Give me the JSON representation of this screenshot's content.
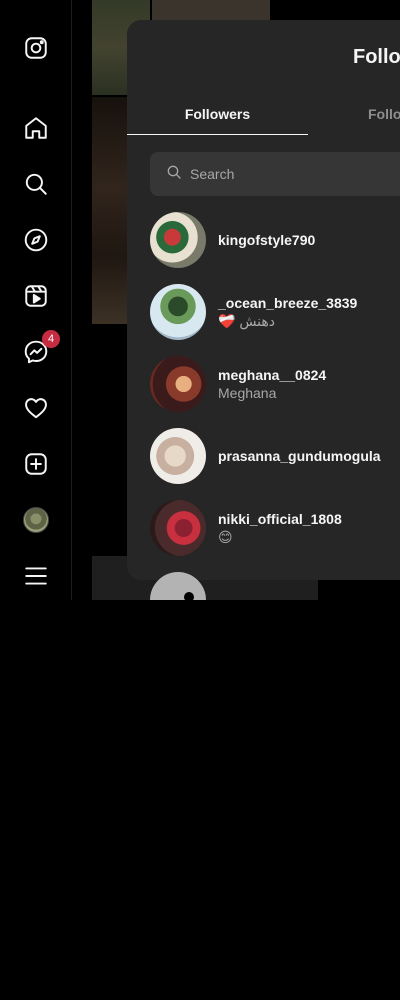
{
  "nav": {
    "items": [
      {
        "icon": "instagram-logo-icon"
      },
      {
        "icon": "home-icon"
      },
      {
        "icon": "search-icon"
      },
      {
        "icon": "explore-compass-icon"
      },
      {
        "icon": "reels-icon"
      },
      {
        "icon": "messenger-icon",
        "badge": "4"
      },
      {
        "icon": "heart-icon"
      },
      {
        "icon": "create-plus-icon"
      },
      {
        "icon": "profile-avatar"
      },
      {
        "icon": "menu-hamburger-icon"
      }
    ],
    "messages_badge": "4"
  },
  "modal": {
    "title": "Follo",
    "tabs": [
      {
        "label": "Followers",
        "active": true
      },
      {
        "label": "Follo",
        "active": false
      }
    ],
    "search": {
      "placeholder": "Search",
      "value": ""
    },
    "users": [
      {
        "username": "kingofstyle790",
        "fullname": ""
      },
      {
        "username": "_ocean_breeze_3839",
        "fullname": "❤️‍🩹 دهنش"
      },
      {
        "username": "meghana__0824",
        "fullname": "Meghana"
      },
      {
        "username": "prasanna_gundumogula",
        "fullname": ""
      },
      {
        "username": "nikki_official_1808",
        "fullname": "😊"
      }
    ]
  },
  "colors": {
    "background": "#000000",
    "modal": "#262626",
    "search_bg": "#363636",
    "badge": "#c72c41",
    "secondary_text": "#a8a8a8"
  }
}
